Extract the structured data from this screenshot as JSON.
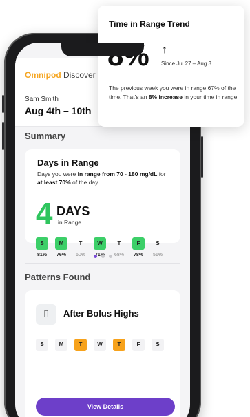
{
  "app": {
    "brand_primary": "Omnipod",
    "brand_secondary": " Discover"
  },
  "user": {
    "name": "Sam Smith",
    "date_range": "Aug 4th – 10th"
  },
  "summary": {
    "section_title": "Summary",
    "card": {
      "title": "Days in Range",
      "desc_parts": [
        "Days you were ",
        "in range from 70 - 180 mg/dL",
        " for ",
        "at least 70%",
        " of the day."
      ],
      "big_number": "4",
      "days_word": "DAYS",
      "in_range_label": "in Range",
      "days": [
        {
          "label": "S",
          "pct": "81%",
          "hit": true
        },
        {
          "label": "M",
          "pct": "76%",
          "hit": true
        },
        {
          "label": "T",
          "pct": "60%",
          "hit": false
        },
        {
          "label": "W",
          "pct": "71%",
          "hit": true
        },
        {
          "label": "T",
          "pct": "68%",
          "hit": false
        },
        {
          "label": "F",
          "pct": "78%",
          "hit": true
        },
        {
          "label": "S",
          "pct": "51%",
          "hit": false
        }
      ]
    },
    "pagination": {
      "count": 3,
      "active": 0
    }
  },
  "patterns": {
    "section_title": "Patterns Found",
    "card": {
      "title": "After Bolus Highs",
      "days": [
        {
          "label": "S",
          "hit": false
        },
        {
          "label": "M",
          "hit": false
        },
        {
          "label": "T",
          "hit": true
        },
        {
          "label": "W",
          "hit": false
        },
        {
          "label": "T",
          "hit": true
        },
        {
          "label": "F",
          "hit": false
        },
        {
          "label": "S",
          "hit": false
        }
      ]
    },
    "cta_label": "View Details"
  },
  "trend_card": {
    "title": "Time in Range Trend",
    "value": "8%",
    "since": "Since Jul 27 – Aug 3",
    "body_parts": [
      "The previous week you were in range 67% of the time. That’s an ",
      "8% increase",
      " in your time in range."
    ]
  },
  "colors": {
    "in_range_green": "#3ccf68",
    "pattern_orange": "#f7a21b",
    "accent_purple": "#6d3fc9",
    "brand_orange": "#f5a623"
  },
  "icons": {
    "next": "chevron-right-icon",
    "pattern": "vial-icon",
    "trend": "arrow-up-icon"
  }
}
